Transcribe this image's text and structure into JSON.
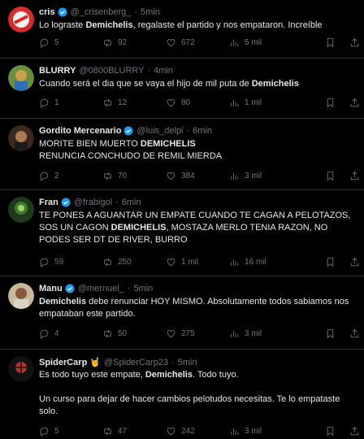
{
  "colors": {
    "background": "#000000",
    "text": "#e7e9ea",
    "muted": "#71767b",
    "divider": "#2f3336",
    "verified": "#1d9bf0"
  },
  "icons": [
    "reply-icon",
    "retweet-icon",
    "like-icon",
    "views-icon",
    "bookmark-icon",
    "share-icon",
    "verified-icon"
  ],
  "tweets": [
    {
      "name": "cris",
      "handle": "@_crisenberg_",
      "dot": "·",
      "time": "5min",
      "verified": true,
      "text_pre": "Lo lograste ",
      "text_bold": "Demichelis",
      "text_post": ", regalaste el partido y nos empataron. Increíble",
      "replies": "5",
      "retweets": "92",
      "likes": "672",
      "views": "5 mil"
    },
    {
      "name": "BLURRY",
      "handle": "@0800BLURRY",
      "dot": "·",
      "time": "4min",
      "verified": false,
      "text_pre": "Cuando será el dia que se vaya el hijo de mil puta de ",
      "text_bold": "Demichelis",
      "text_post": "",
      "replies": "1",
      "retweets": "12",
      "likes": "80",
      "views": "1 mil"
    },
    {
      "name": "Gordito Mercenario",
      "handle": "@luis_delpi",
      "dot": "·",
      "time": "6min",
      "verified": true,
      "text_pre": "MORITE BIEN MUERTO ",
      "text_bold": "DEMICHELIS",
      "text_post": "\nRENUNCIA CONCHUDO DE REMIL MIERDA",
      "replies": "2",
      "retweets": "70",
      "likes": "384",
      "views": "3 mil"
    },
    {
      "name": "Fran",
      "handle": "@frabigol",
      "dot": "·",
      "time": "6min",
      "verified": true,
      "text_pre": "TE PONES A AGUANTAR UN EMPATE CUANDO TE CAGAN A PELOTAZOS, SOS UN CAGON ",
      "text_bold": "DEMICHELIS",
      "text_post": ", MOSTAZA MERLO TENIA RAZON, NO PODES SER DT DE RIVER, BURRO",
      "replies": "59",
      "retweets": "250",
      "likes": "1 mil",
      "views": "16 mil"
    },
    {
      "name": "Manu",
      "handle": "@mernuel_",
      "dot": "·",
      "time": "5min",
      "verified": true,
      "text_pre": "",
      "text_bold": "Demichelis",
      "text_post": " debe renunciar HOY MISMO. Absolutamente todos sabiamos nos empataban este partido.",
      "replies": "4",
      "retweets": "50",
      "likes": "275",
      "views": "3 mil"
    },
    {
      "name": "SpiderCarp",
      "handle": "@SpiderCarp23",
      "dot": "·",
      "time": "5min",
      "verified": false,
      "emoji": "🤘",
      "text_pre": "Es todo tuyo este empate, ",
      "text_bold": "Demichelis",
      "text_post": ". Todo tuyo.\n\nUn curso para dejar de hacer cambios pelotudos necesitas. Te lo empataste solo.",
      "replies": "5",
      "retweets": "47",
      "likes": "242",
      "views": "3 mil"
    }
  ]
}
